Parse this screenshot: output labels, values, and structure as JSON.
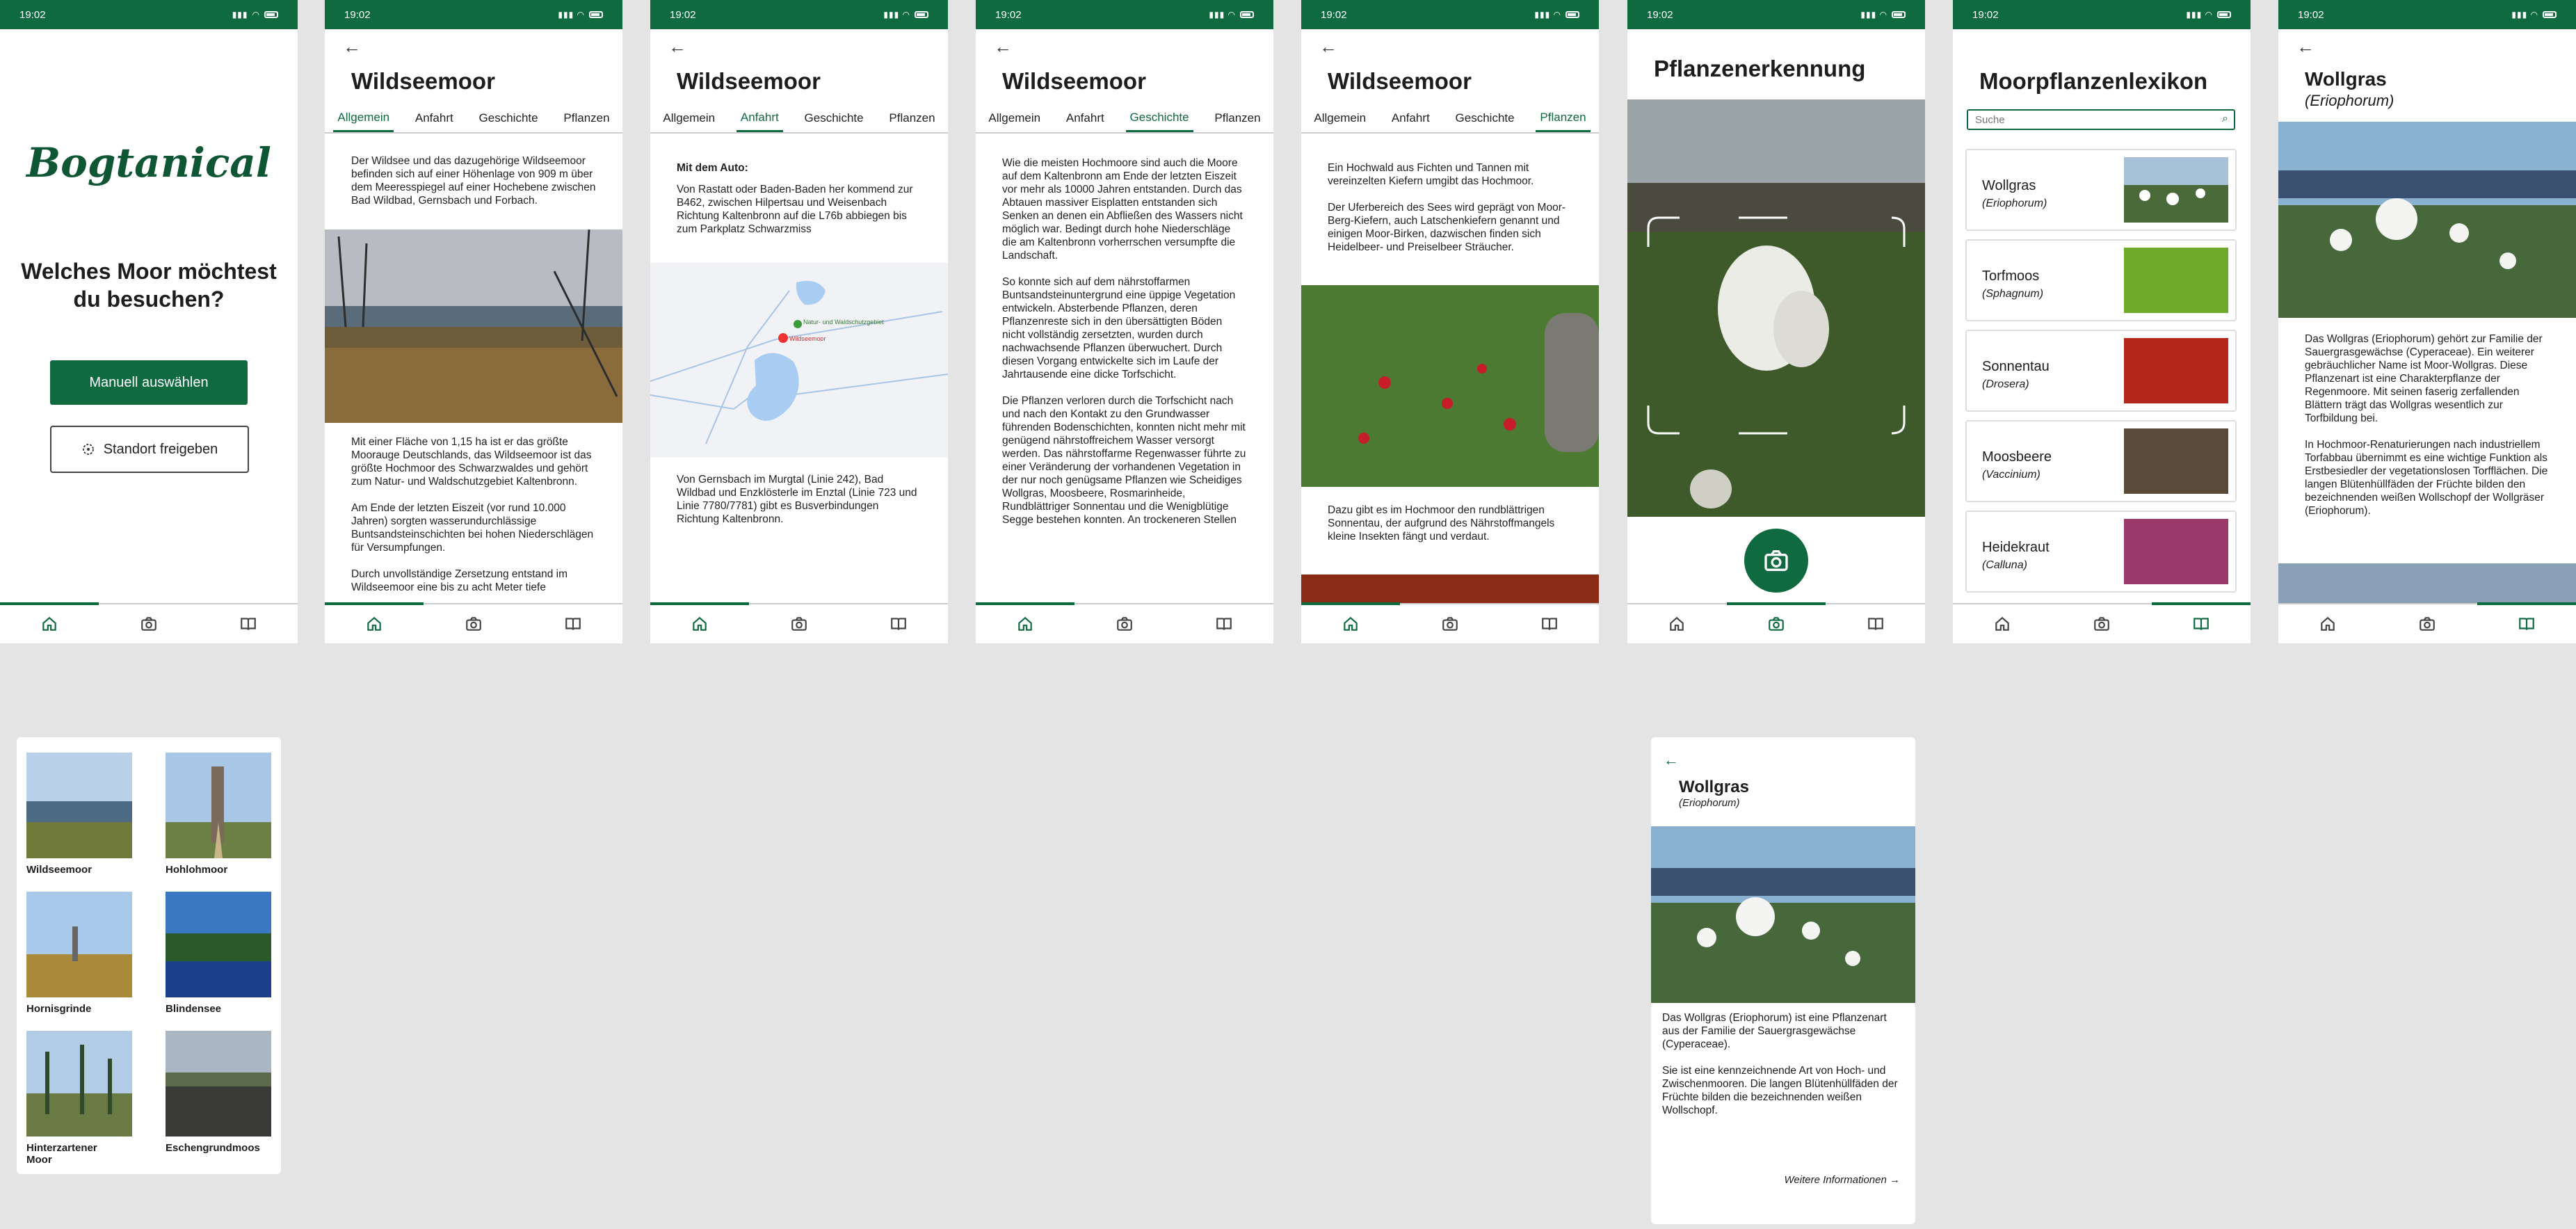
{
  "status": {
    "time": "19:02",
    "indicators": "▮▮▮ ◠"
  },
  "welcome": {
    "logo": "Bogtanical",
    "question": "Welches Moor möchtest du besuchen?",
    "manual_button": "Manuell auswählen",
    "location_button": "Standort freigeben"
  },
  "moor": {
    "title": "Wildseemoor"
  },
  "tabs": [
    "Allgemein",
    "Anfahrt",
    "Geschichte",
    "Pflanzen"
  ],
  "allgemein": {
    "p1": "Der Wildsee und das dazugehörige Wildseemoor befinden sich auf einer Höhenlage von 909 m über dem Meeresspiegel auf einer Hochebene zwischen Bad Wildbad, Gernsbach und Forbach.",
    "p2": "Mit einer Fläche von 1,15 ha ist er das größte Moorauge Deutschlands, das Wildseemoor ist das größte Hochmoor des Schwarzwaldes und gehört zum Natur- und Waldschutzgebiet Kaltenbronn.",
    "p3": "Am Ende der letzten Eiszeit (vor rund 10.000 Jahren) sorgten wasserundurchlässige Buntsandsteinschichten bei hohen Niederschlägen für Versumpfungen.",
    "p4": "Durch unvollständige Zersetzung entstand im Wildseemoor eine bis zu acht Meter tiefe"
  },
  "anfahrt": {
    "heading": "Mit dem Auto:",
    "p1": "Von Rastatt oder Baden-Baden her kommend zur B462, zwischen Hilpertsau und Weisenbach Richtung Kaltenbronn auf die L76b abbiegen bis zum Parkplatz Schwarzmiss",
    "map_label_1": "Natur- und Waldschutzgebiet",
    "map_label_2": "Wildseemoor",
    "p2": "Von Gernsbach im Murgtal (Linie 242), Bad Wildbad und Enzklösterle im Enztal (Linie 723 und Linie 7780/7781) gibt es Busverbindungen Richtung Kaltenbronn."
  },
  "geschichte": {
    "p1": "Wie die meisten Hochmoore sind auch die Moore auf dem Kaltenbronn am Ende der letzten Eiszeit vor mehr als 10000 Jahren entstanden. Durch das Abtauen massiver Eisplatten entstanden sich Senken an denen ein Abfließen des Wassers nicht möglich war. Bedingt durch hohe Niederschläge die am Kaltenbronn vorherrschen versumpfte die Landschaft.",
    "p2": "So konnte sich auf dem nährstoffarmen Buntsandsteinuntergrund eine üppige Vegetation entwickeln. Absterbende Pflanzen, deren Pflanzenreste sich in den übersättigten Böden nicht vollständig zersetzten, wurden durch nachwachsende Pflanzen überwuchert. Durch diesen Vorgang entwickelte sich im Laufe der Jahrtausende eine dicke Torfschicht.",
    "p3": "Die Pflanzen verloren durch die Torfschicht nach und nach den Kontakt zu den Grundwasser führenden Bodenschichten, konnten nicht mehr mit genügend nährstoffreichem Wasser versorgt werden. Das nährstoffarme Regenwasser führte zu einer Veränderung der vorhandenen Vegetation in der nur noch genügsame Pflanzen wie Scheidiges Wollgras, Moosbeere, Rosmarinheide, Rundblättriger Sonnentau und die Wenigblütige Segge bestehen konnten. An trockeneren Stellen"
  },
  "pflanzen": {
    "p1": "Ein Hochwald aus Fichten und Tannen mit vereinzelten Kiefern umgibt das Hochmoor.",
    "p2": "Der Uferbereich des Sees wird geprägt von Moor-Berg-Kiefern, auch Latschenkiefern genannt und einigen Moor-Birken, dazwischen finden sich Heidelbeer- und Preiselbeer Sträucher.",
    "p3": "Dazu gibt es im Hochmoor den rundblättrigen Sonnentau, der aufgrund des Nährstoffmangels kleine Insekten fängt und verdaut."
  },
  "erkennung": {
    "title": "Pflanzenerkennung"
  },
  "lexikon": {
    "title": "Moorpflanzenlexikon",
    "search_placeholder": "Suche",
    "items": [
      {
        "name": "Wollgras",
        "latin": "(Eriophorum)"
      },
      {
        "name": "Torfmoos",
        "latin": "(Sphagnum)"
      },
      {
        "name": "Sonnentau",
        "latin": "(Drosera)"
      },
      {
        "name": "Moosbeere",
        "latin": "(Vaccinium)"
      },
      {
        "name": "Heidekraut",
        "latin": "(Calluna)"
      }
    ]
  },
  "wollgras": {
    "title": "Wollgras",
    "latin": "(Eriophorum)",
    "p1": "Das Wollgras (Eriophorum) gehört zur Familie der Sauergrasgewächse (Cyperaceae). Ein weiterer gebräuchlicher Name ist Moor-Wollgras. Diese Pflanzenart ist eine Charakterpflanze der Regenmoore. Mit seinen faserig zerfallenden Blättern trägt das Wollgras wesentlich zur Torfbildung bei.",
    "p2": "In Hochmoor-Renaturierungen nach industriellem Torfabbau übernimmt es eine wichtige Funktion als Erstbesiedler der vegetationslosen Torfflächen. Die langen Blütenhüllfäden der Früchte bilden den bezeichnenden weißen Wollschopf der Wollgräser (Eriophorum)."
  },
  "moor_grid": [
    "Wildseemoor",
    "Hohlohmoor",
    "Hornisgrinde",
    "Blindensee",
    "Hinterzartener Moor",
    "Eschengrundmoos"
  ],
  "popup": {
    "title": "Wollgras",
    "latin": "(Eriophorum)",
    "p1": "Das Wollgras (Eriophorum) ist eine Pflanzenart aus der Familie der Sauergrasgewächse (Cyperaceae).",
    "p2": "Sie ist eine kennzeichnende Art von Hoch- und Zwischenmooren. Die langen Blütenhüllfäden der Früchte bilden die bezeichnenden weißen Wollschopf.",
    "more_link": "Weitere Informationen"
  },
  "colors": {
    "brand": "#0f6a3f",
    "background": "#e4e4e4"
  }
}
